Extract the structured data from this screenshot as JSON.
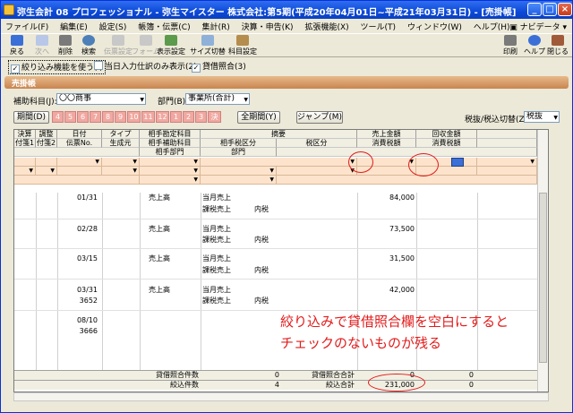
{
  "window": {
    "title": "弥生会計 08 プロフェッショナル - 弥生マイスター 株式会社:第5期(平成20年04月01日~平成21年03月31日) - [売掛帳]"
  },
  "menu": [
    "ファイル(F)",
    "編集(E)",
    "設定(S)",
    "帳簿・伝票(C)",
    "集計(R)",
    "決算・申告(K)",
    "拡張機能(X)",
    "ツール(T)",
    "ウィンドウ(W)",
    "ヘルプ(H)"
  ],
  "navi_label": "ナビデータ",
  "toolbar": {
    "left": [
      "戻る",
      "次へ",
      "削除",
      "検索",
      "伝票設定",
      "フォーム",
      "表示設定",
      "サイズ切替",
      "科目設定"
    ],
    "right": [
      "印刷",
      "ヘルプ",
      "閉じる"
    ]
  },
  "options": {
    "opt1": "絞り込み機能を使う(I)",
    "opt2": "当日入力仕訳のみ表示(2)",
    "opt3": "貸借照合(3)"
  },
  "banner": "売掛帳",
  "form": {
    "sub_label": "補助科目(J):",
    "sub_value": "〇〇商事",
    "dept_label": "部門(B):",
    "dept_value": "事業所(合計)",
    "period_btn": "期間(D)",
    "months": [
      "4",
      "5",
      "6",
      "7",
      "8",
      "9",
      "10",
      "11",
      "12",
      "1",
      "2",
      "3",
      "決"
    ],
    "all_btn": "全期間(Y)",
    "jump_btn": "ジャンプ(M)",
    "tax_label": "税抜/税込切替(Z)",
    "tax_value": "税抜"
  },
  "headers": {
    "r1": [
      "決算",
      "調整",
      "日付",
      "タイプ",
      "相手勘定科目",
      "摘要",
      "売上金額",
      "回収金額"
    ],
    "r2": [
      "付箋1",
      "付箋2",
      "伝票No.",
      "生成元",
      "相手補助科目",
      "相手税区分",
      "税区分",
      "消費税額",
      "消費税額"
    ],
    "r3": [
      "相手部門",
      "部門"
    ]
  },
  "rows": [
    {
      "date": "01/31",
      "account": "売上高",
      "memo": "当月売上",
      "tax": "課税売上",
      "taxin": "内税",
      "amount": "84,000"
    },
    {
      "date": "02/28",
      "account": "売上高",
      "memo": "当月売上",
      "tax": "課税売上",
      "taxin": "内税",
      "amount": "73,500"
    },
    {
      "date": "03/15",
      "account": "売上高",
      "memo": "当月売上",
      "tax": "課税売上",
      "taxin": "内税",
      "amount": "31,500"
    },
    {
      "date": "03/31",
      "slip": "3652",
      "account": "売上高",
      "memo": "当月売上",
      "tax": "課税売上",
      "taxin": "内税",
      "amount": "42,000"
    },
    {
      "date": "08/10",
      "slip": "3666"
    }
  ],
  "summary": {
    "l1": "貸借照合件数",
    "v1": "0",
    "l2": "貸借照合合計",
    "v2": "0",
    "v3": "0",
    "l3": "絞込件数",
    "v4": "4",
    "l4": "絞込合計",
    "v5": "231,000",
    "v6": "0"
  },
  "annotation": {
    "line1": "絞り込みで貸借照合欄を空白にすると",
    "line2": "チェックのないものが残る"
  }
}
